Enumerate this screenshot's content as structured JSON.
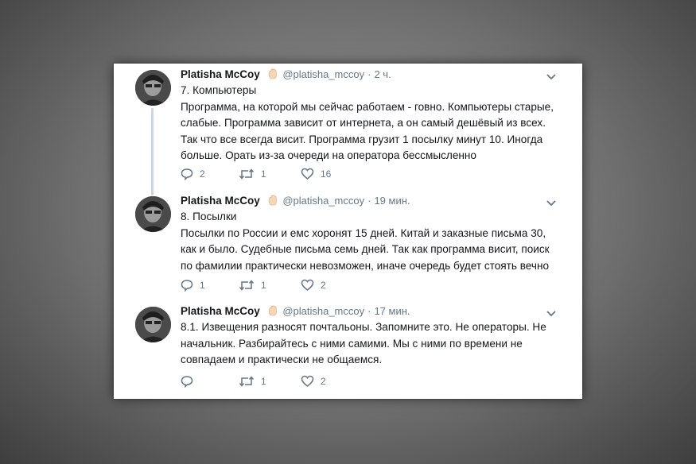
{
  "tweets": [
    {
      "name": "Platisha McCoy",
      "handle": "@platisha_mccoy",
      "separator": "·",
      "time": "2 ч.",
      "lines": [
        "7. Компьютеры",
        "Программа, на которой мы сейчас работаем - говно. Компьютеры старые,",
        "слабые. Программа зависит от интернета, а он самый дешёвый из всех.",
        "Так что все всегда висит. Программа грузит 1 посылку минут 10. Иногда",
        "больше. Орать из-за очереди на оператора бессмысленно"
      ],
      "replies": "2",
      "retweets": "1",
      "likes": "16"
    },
    {
      "name": "Platisha McCoy",
      "handle": "@platisha_mccoy",
      "separator": "·",
      "time": "19 мин.",
      "lines": [
        "8. Посылки",
        "Посылки по России и емс хоронят 15 дней. Китай и заказные письма 30,",
        "как и было. Судебные письма семь дней. Так как программа висит, поиск",
        "по фамилии практически невозможен, иначе очередь будет стоять вечно"
      ],
      "replies": "1",
      "retweets": "1",
      "likes": "2"
    },
    {
      "name": "Platisha McCoy",
      "handle": "@platisha_mccoy",
      "separator": "·",
      "time": "17 мин.",
      "lines": [
        "8.1. Извещения разносят почтальоны. Запомните это. Не операторы. Не",
        "начальник. Разбирайтесь с ними самими. Мы с ними по времени не",
        "совпадаем и практически не общаемся."
      ],
      "replies": "",
      "retweets": "1",
      "likes": "2"
    }
  ],
  "icons": {
    "reply": "reply-icon",
    "retweet": "retweet-icon",
    "like": "heart-icon",
    "menu": "chevron-down-icon",
    "emoji": "raised-hand-icon"
  },
  "colors": {
    "thread_line": "#c5d7e8",
    "text": "#14171a",
    "meta": "#657786"
  }
}
